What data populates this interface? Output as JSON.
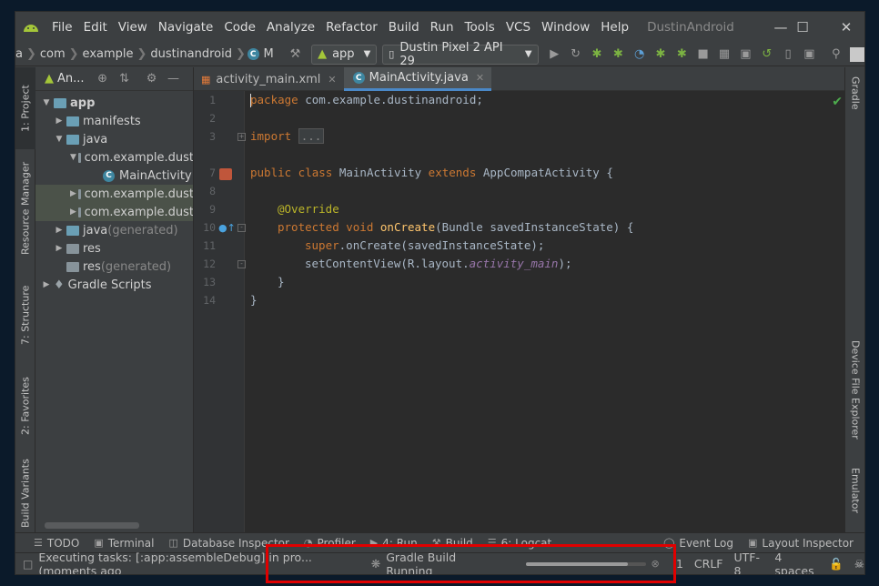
{
  "titlebar": {
    "menu": [
      "File",
      "Edit",
      "View",
      "Navigate",
      "Code",
      "Analyze",
      "Refactor",
      "Build",
      "Run",
      "Tools",
      "VCS",
      "Window",
      "Help"
    ],
    "app_title": "DustinAndroid"
  },
  "navbar": {
    "breadcrumbs": [
      "a",
      "com",
      "example",
      "dustinandroid",
      "M"
    ],
    "run_config": "app",
    "device": "Dustin Pixel 2 API 29"
  },
  "left_strip": {
    "project": "1: Project",
    "resource_manager": "Resource Manager",
    "structure": "7: Structure",
    "favorites": "2: Favorites",
    "build_variants": "Build Variants"
  },
  "right_strip": {
    "gradle": "Gradle",
    "device_file_explorer": "Device File Explorer",
    "emulator": "Emulator"
  },
  "project_panel": {
    "view_label": "An...",
    "tree": [
      {
        "label": "app",
        "gen": ""
      },
      {
        "label": "manifests",
        "gen": ""
      },
      {
        "label": "java",
        "gen": ""
      },
      {
        "label": "com.example.dust",
        "gen": ""
      },
      {
        "label": "MainActivity",
        "gen": ""
      },
      {
        "label": "com.example.dust",
        "gen": ""
      },
      {
        "label": "com.example.dust",
        "gen": ""
      },
      {
        "label": "java",
        "gen": " (generated)"
      },
      {
        "label": "res",
        "gen": ""
      },
      {
        "label": "res",
        "gen": " (generated)"
      },
      {
        "label": "Gradle Scripts",
        "gen": ""
      }
    ]
  },
  "editor": {
    "tabs": [
      "activity_main.xml",
      "MainActivity.java"
    ],
    "line_numbers": [
      "1",
      "2",
      "3",
      "7",
      "8",
      "9",
      "10",
      "11",
      "12",
      "13",
      "14"
    ],
    "code": {
      "l1_kw": "package",
      "l1_rest": " com.example.dustinandroid;",
      "l3_kw": "import",
      "l3_fold": "...",
      "l7_kw1": "public class",
      "l7_name": " MainActivity ",
      "l7_kw2": "extends",
      "l7_rest": " AppCompatActivity {",
      "l9_ann": "@Override",
      "l10_kw": "protected void",
      "l10_fn": "onCreate",
      "l10_rest": "(Bundle savedInstanceState) {",
      "l11_kw": "super",
      "l11_rest": ".onCreate(savedInstanceState);",
      "l12_rest": "setContentView(R.layout.",
      "l12_it": "activity_main",
      "l12_end": ");",
      "l13": "}",
      "l14": "}"
    }
  },
  "bottom_tabs": [
    "TODO",
    "Terminal",
    "Database Inspector",
    "Profiler",
    "4: Run",
    "Build",
    "6: Logcat",
    "Event Log",
    "Layout Inspector"
  ],
  "status": {
    "message": "Executing tasks: [:app:assembleDebug] in pro... (moments ago",
    "task": "Gradle Build Running",
    "position": ":1",
    "line_sep": "CRLF",
    "encoding": "UTF-8",
    "indent": "4 spaces",
    "progress": 0.85
  }
}
